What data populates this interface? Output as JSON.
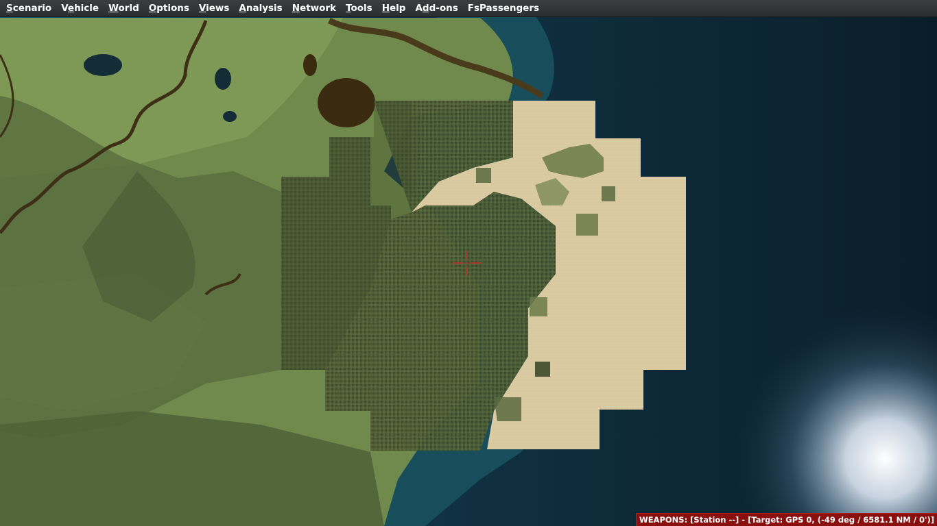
{
  "menu": {
    "items": [
      {
        "pre": "",
        "acc": "S",
        "post": "cenario"
      },
      {
        "pre": "V",
        "acc": "e",
        "post": "hicle"
      },
      {
        "pre": "",
        "acc": "W",
        "post": "orld"
      },
      {
        "pre": "",
        "acc": "O",
        "post": "ptions"
      },
      {
        "pre": "",
        "acc": "V",
        "post": "iews"
      },
      {
        "pre": "",
        "acc": "A",
        "post": "nalysis"
      },
      {
        "pre": "",
        "acc": "N",
        "post": "etwork"
      },
      {
        "pre": "",
        "acc": "T",
        "post": "ools"
      },
      {
        "pre": "",
        "acc": "H",
        "post": "elp"
      },
      {
        "pre": "A",
        "acc": "d",
        "post": "d-ons"
      },
      {
        "pre": "FsPassengers",
        "acc": "",
        "post": ""
      }
    ]
  },
  "status": {
    "weapons": "WEAPONS: [Station --] - [Target: GPS 0, (-49 deg / 6581.1 NM / 0')]"
  },
  "colors": {
    "menubar": "#2f3235",
    "land": "#6f8a4c",
    "forest": "#4b5a34",
    "sand": "#d8c8a0",
    "ocean": "#0d2430",
    "status_bg": "#8a1010",
    "crosshair": "#c0302a"
  },
  "icons": {
    "crosshair": "crosshair-icon"
  }
}
